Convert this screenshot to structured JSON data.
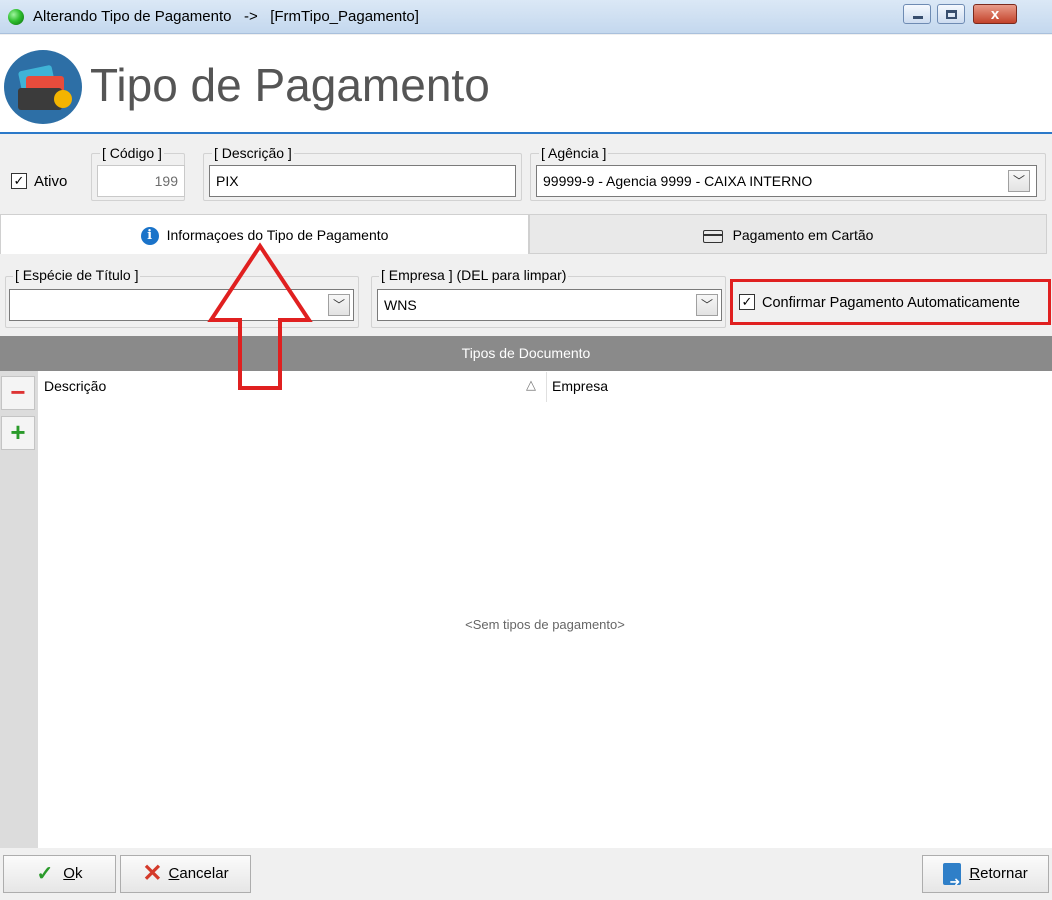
{
  "window": {
    "title": "Alterando Tipo de Pagamento   ->   [FrmTipo_Pagamento]",
    "close_glyph": "x"
  },
  "header": {
    "title": "Tipo de Pagamento"
  },
  "form": {
    "ativo_label": "Ativo",
    "ativo_checked": true,
    "codigo_label": "[ Código ]",
    "codigo_value": "199",
    "descricao_label": "[ Descrição ]",
    "descricao_value": "PIX",
    "agencia_label": "[ Agência ]",
    "agencia_value": "99999-9 - Agencia 9999 - CAIXA INTERNO"
  },
  "tabs": [
    {
      "label": "Informaçoes do Tipo de Pagamento",
      "icon": "info-icon",
      "active": true
    },
    {
      "label": "Pagamento em Cartão",
      "icon": "credit-card-icon",
      "active": false
    }
  ],
  "tab_content": {
    "especie_label": "[ Espécie de Título ]",
    "especie_value": "",
    "empresa_label": "[ Empresa ]  (DEL para limpar)",
    "empresa_value": "WNS",
    "confirmar_label": "Confirmar Pagamento Automaticamente",
    "confirmar_checked": true
  },
  "tipos_documento": {
    "title": "Tipos de Documento",
    "columns": [
      "Descrição",
      "Empresa"
    ],
    "sort_glyph": "△",
    "empty_text": "<Sem tipos de pagamento>",
    "remove_glyph": "−",
    "add_glyph": "+"
  },
  "buttons": {
    "ok_rest": "k",
    "ok_mnemonic": "O",
    "cancelar_mnemonic": "C",
    "cancelar_rest": "ancelar",
    "retornar_mnemonic": "R",
    "retornar_rest": "etornar"
  },
  "colors": {
    "accent": "#2b79c9",
    "highlight": "#e02020",
    "section_bar": "#8a8a8a"
  }
}
